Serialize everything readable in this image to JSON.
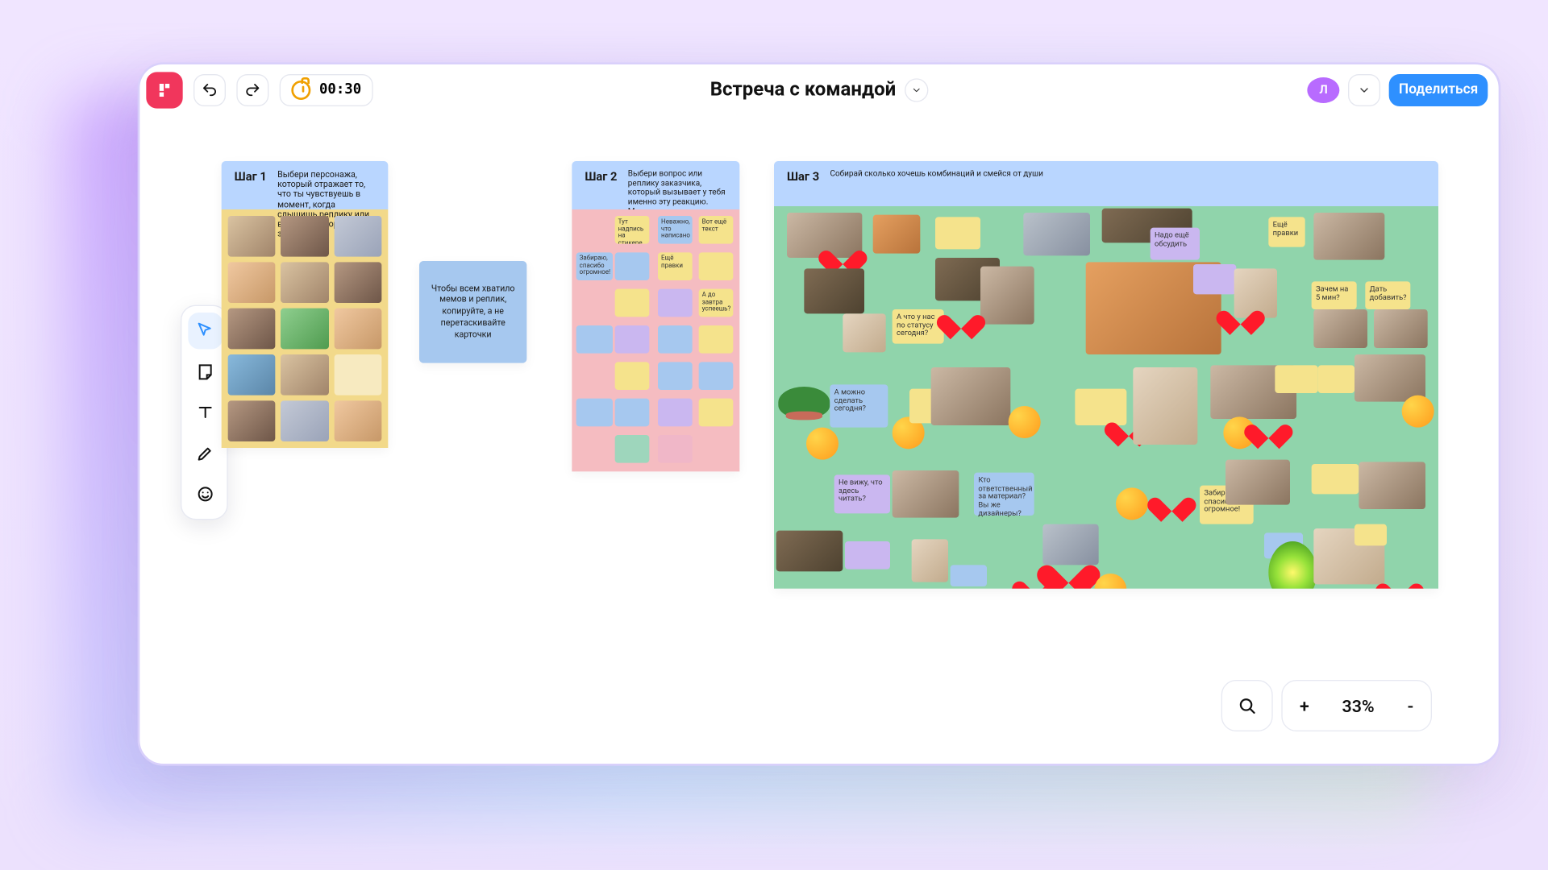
{
  "header": {
    "title": "Встреча с командой",
    "timer": "00:30",
    "avatar_letter": "Л",
    "share_label": "Поделиться"
  },
  "zoom": {
    "value": "33%",
    "plus": "+",
    "minus": "-"
  },
  "tip": {
    "text": "Чтобы всем хватило мемов и реплик, копируйте, а не перетаскивайте карточки"
  },
  "step1": {
    "tag": "Шаг 1",
    "desc": "Выбери персонажа, который отражает то, что ты чувствуешь в момент, когда слышишь реплику или вопрос со стороны заказчика"
  },
  "step2": {
    "tag": "Шаг 2",
    "desc": "Выбери вопрос или реплику заказчика, который вызывает у тебя именно эту реакцию. Можно написать свою",
    "notes": {
      "a": "Тут надпись на стикере",
      "b": "Неважно, что написано",
      "c": "Вот ещё текст",
      "d": "Забираю, спасибо огромное!",
      "e": "Ещё правки",
      "f": "А до завтра успеешь?"
    }
  },
  "step3": {
    "tag": "Шаг 3",
    "desc": "Собирай сколько хочешь комбинаций и смейся от души",
    "notes": {
      "n1": "Ещё правки",
      "n2": "А можно сделать сегодня?",
      "n3": "Не вижу, что здесь читать?",
      "n4": "Кто ответственный за материал? Вы же дизайнеры?",
      "n5": "Забираю, спасибо огромное!",
      "n6": "А что у нас по статусу сегодня?",
      "n7": "Надо ещё обсудить",
      "n8": "Зачем на 5 мин?",
      "n9": "Дать добавить?"
    }
  }
}
